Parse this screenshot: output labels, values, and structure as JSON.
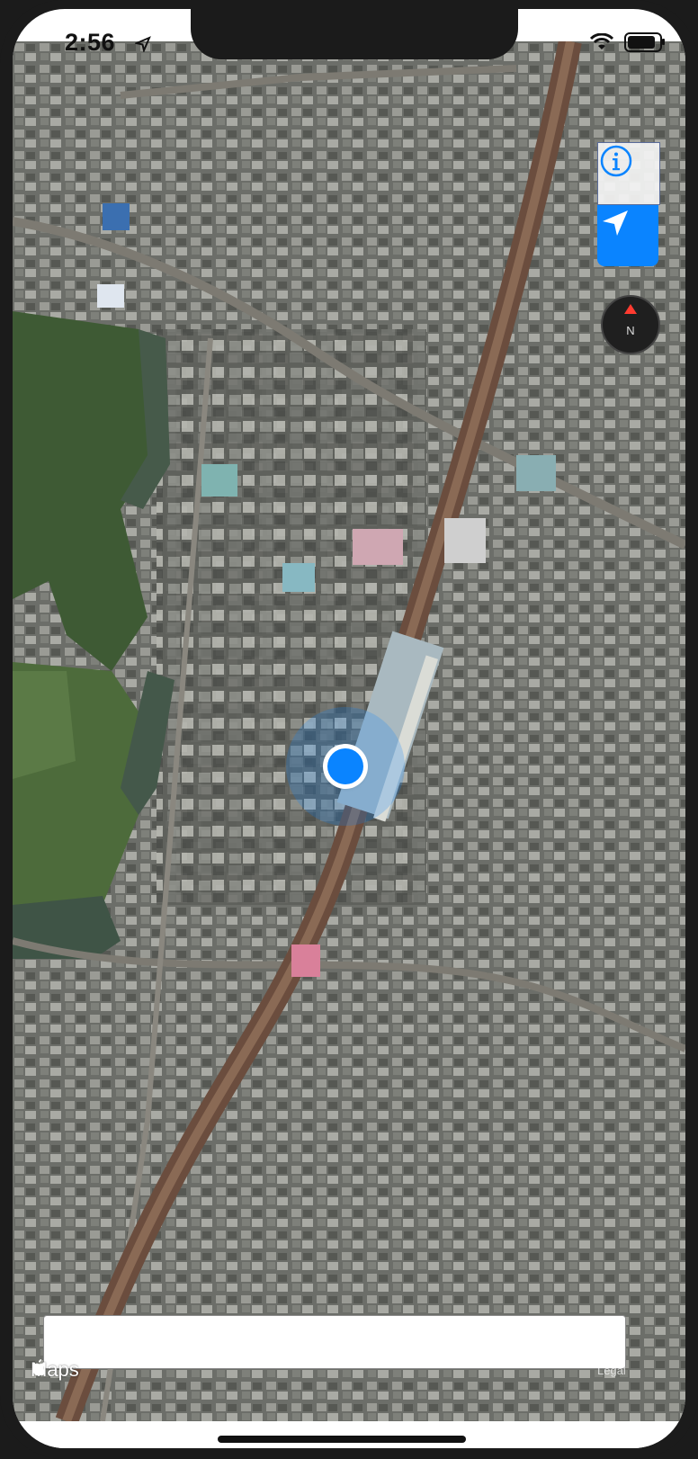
{
  "status_bar": {
    "time": "2:56",
    "location_icon": "location-arrow-icon",
    "wifi_icon": "wifi-icon",
    "battery_icon": "battery-icon"
  },
  "map": {
    "style": "satellite",
    "user_location_icon": "user-location-dot"
  },
  "controls": {
    "info_icon": "info-icon",
    "locate_icon": "navigation-arrow-icon",
    "compass_label": "N"
  },
  "attribution": {
    "logo_text": "Maps",
    "legal_text": "Legal"
  },
  "search": {
    "placeholder": ""
  },
  "colors": {
    "accent": "#0a84ff",
    "compass_needle": "#ff3b30"
  }
}
